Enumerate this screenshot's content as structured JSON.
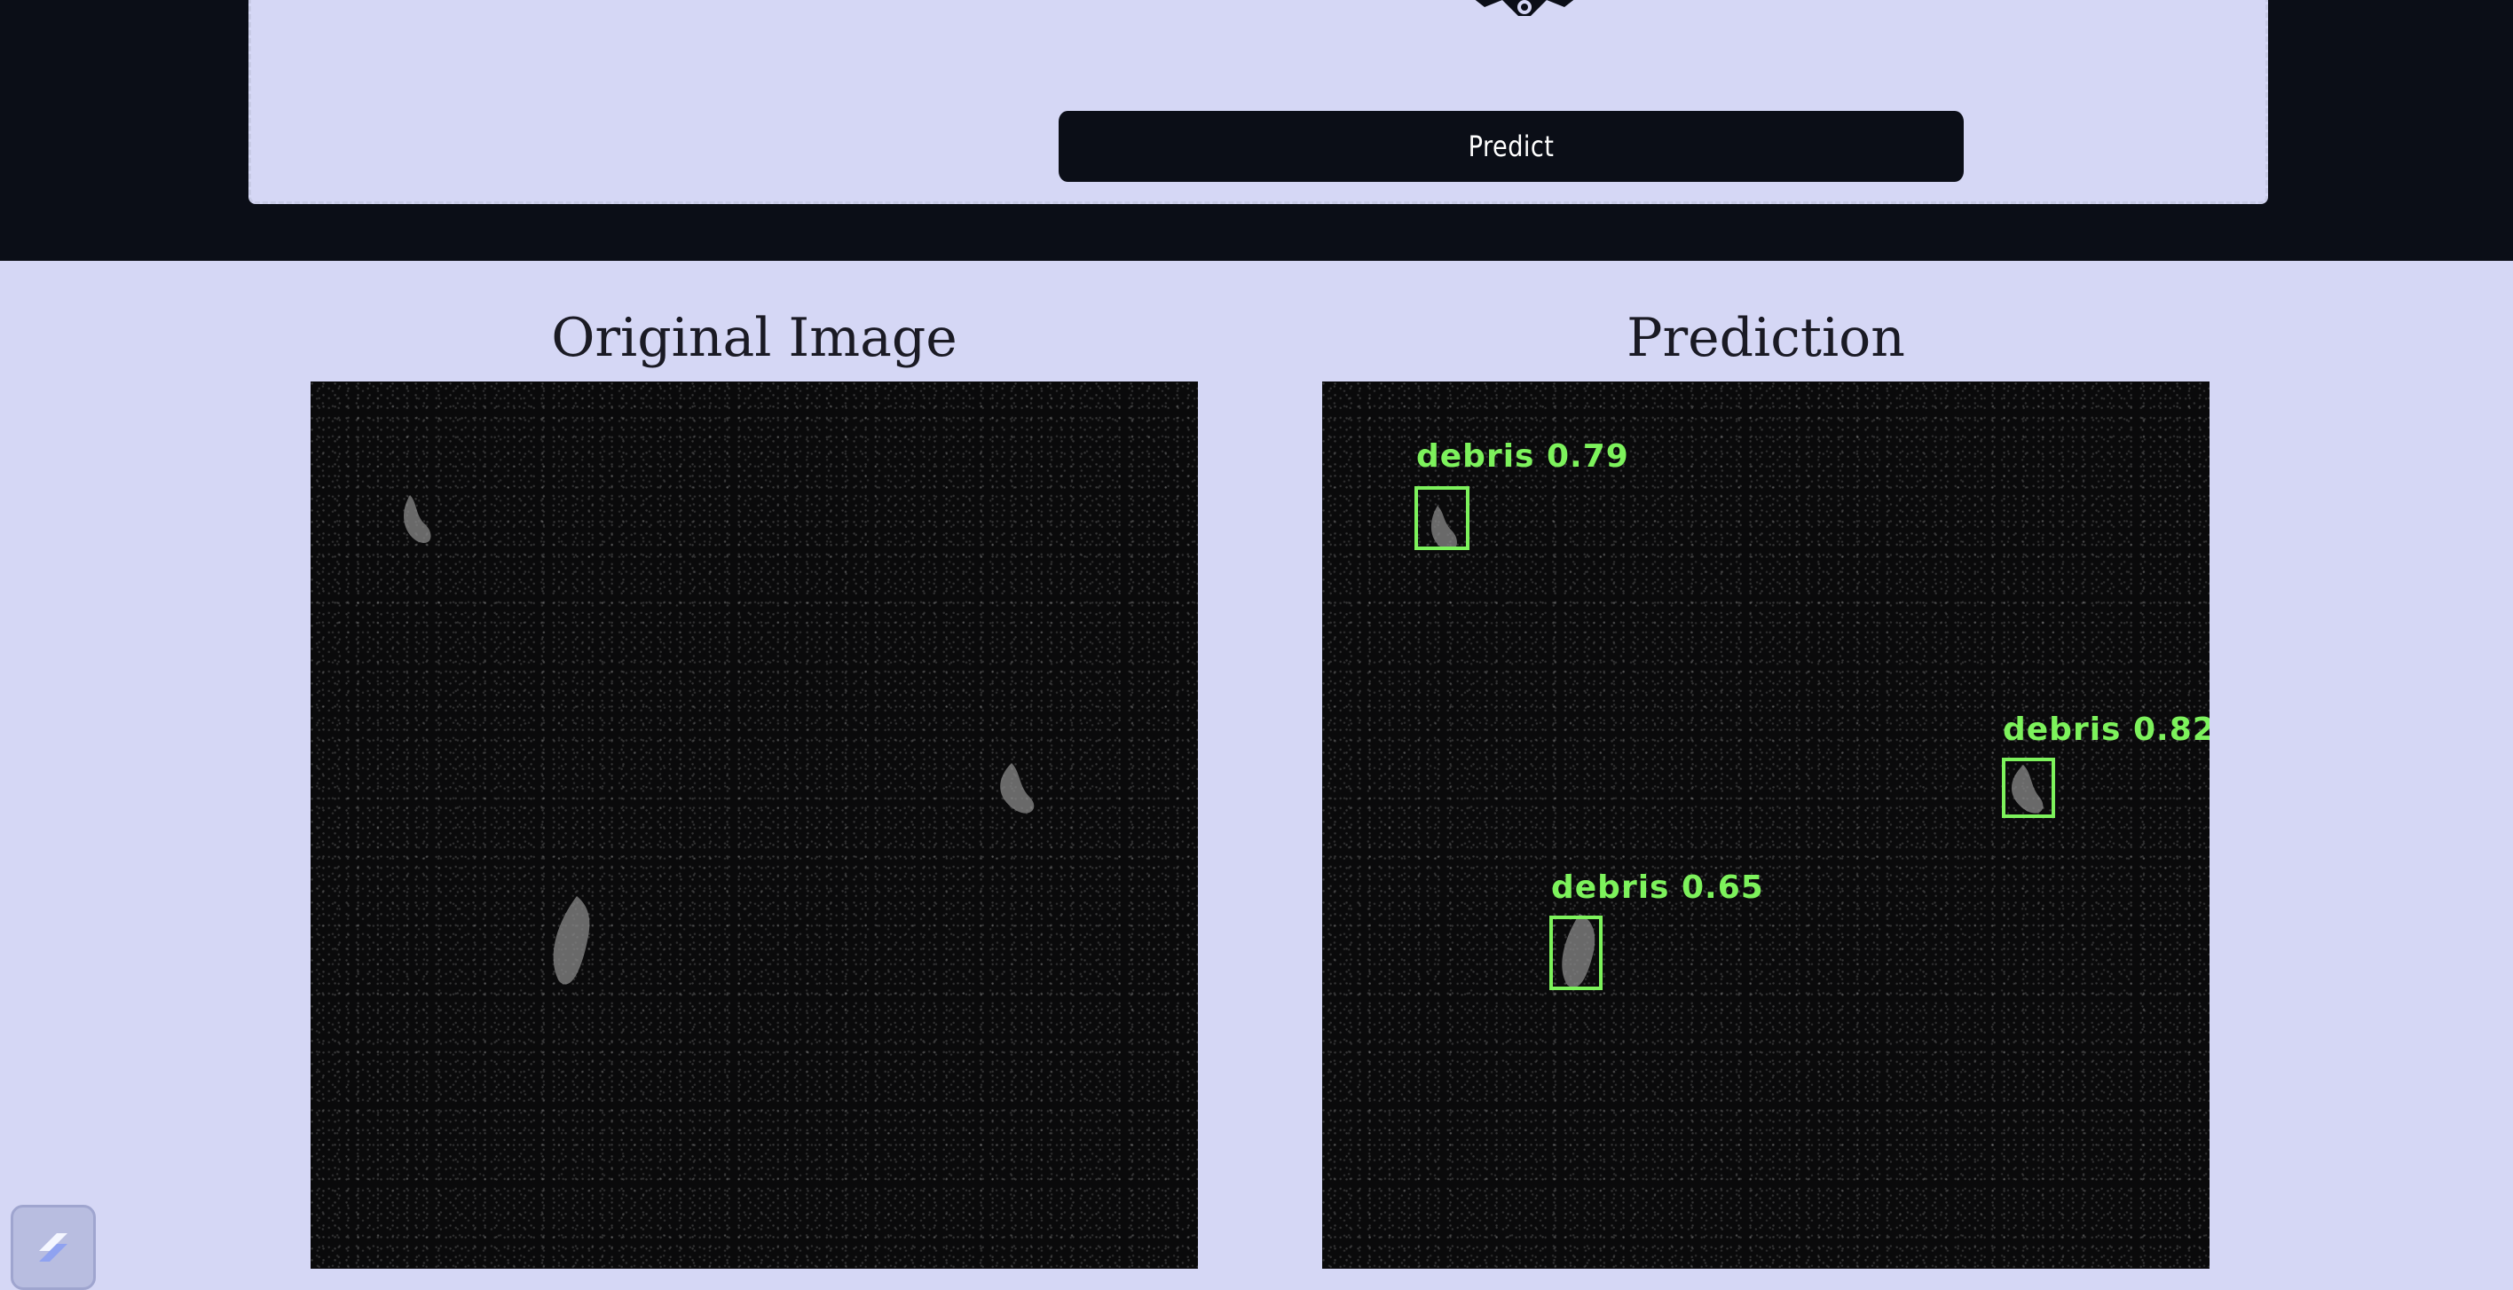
{
  "colors": {
    "page_background": "#d5d7f5",
    "header_background": "#0b0e17",
    "button_background": "#0b0e17",
    "button_text": "#ffffff",
    "detection_green": "#7df25c"
  },
  "upload_panel": {
    "icon": "upload-badge-icon",
    "predict_label": "Predict"
  },
  "results": {
    "original_title": "Original Image",
    "prediction_title": "Prediction",
    "detections": [
      {
        "label": "debris 0.79"
      },
      {
        "label": "debris 0.82"
      },
      {
        "label": "debris 0.65"
      }
    ]
  },
  "corner_widget": {
    "icon": "app-logo-icon"
  }
}
